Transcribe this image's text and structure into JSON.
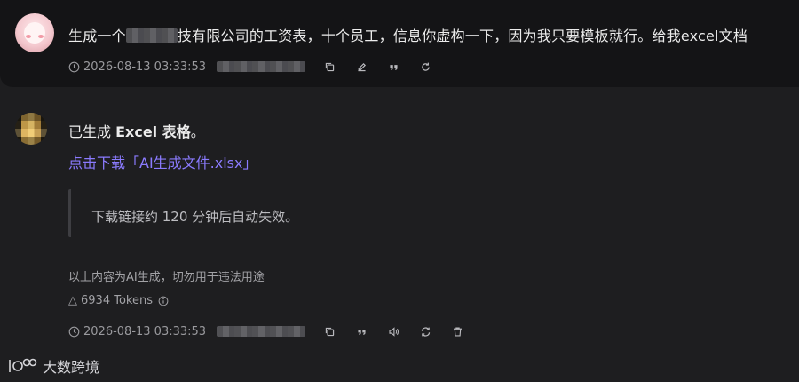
{
  "user_message": {
    "text_prefix": "生成一个",
    "text_suffix": "技有限公司的工资表，十个员工，信息你虚构一下，因为我只要模板就行。给我excel文档",
    "timestamp": "2026-08-13 03:33:53",
    "actions": [
      "copy-icon",
      "edit-icon",
      "quote-icon",
      "refresh-icon"
    ]
  },
  "bot_message": {
    "line1_prefix": "已生成 ",
    "line1_bold": "Excel 表格",
    "line1_suffix": "。",
    "download_link": "点击下载「AI生成文件.xlsx」",
    "quote_text": "下载链接约 120 分钟后自动失效。",
    "disclaimer": "以上内容为AI生成，切勿用于违法用途",
    "tokens_label": "6934 Tokens",
    "timestamp": "2026-08-13 03:33:53",
    "actions": [
      "copy-icon",
      "quote-icon",
      "speaker-icon",
      "regenerate-icon",
      "delete-icon"
    ]
  },
  "watermark": {
    "text": "大数跨境"
  },
  "colors": {
    "background": "#1e1e20",
    "user_block": "#141416",
    "link": "#8b7bff",
    "muted": "#9a9a9e"
  }
}
